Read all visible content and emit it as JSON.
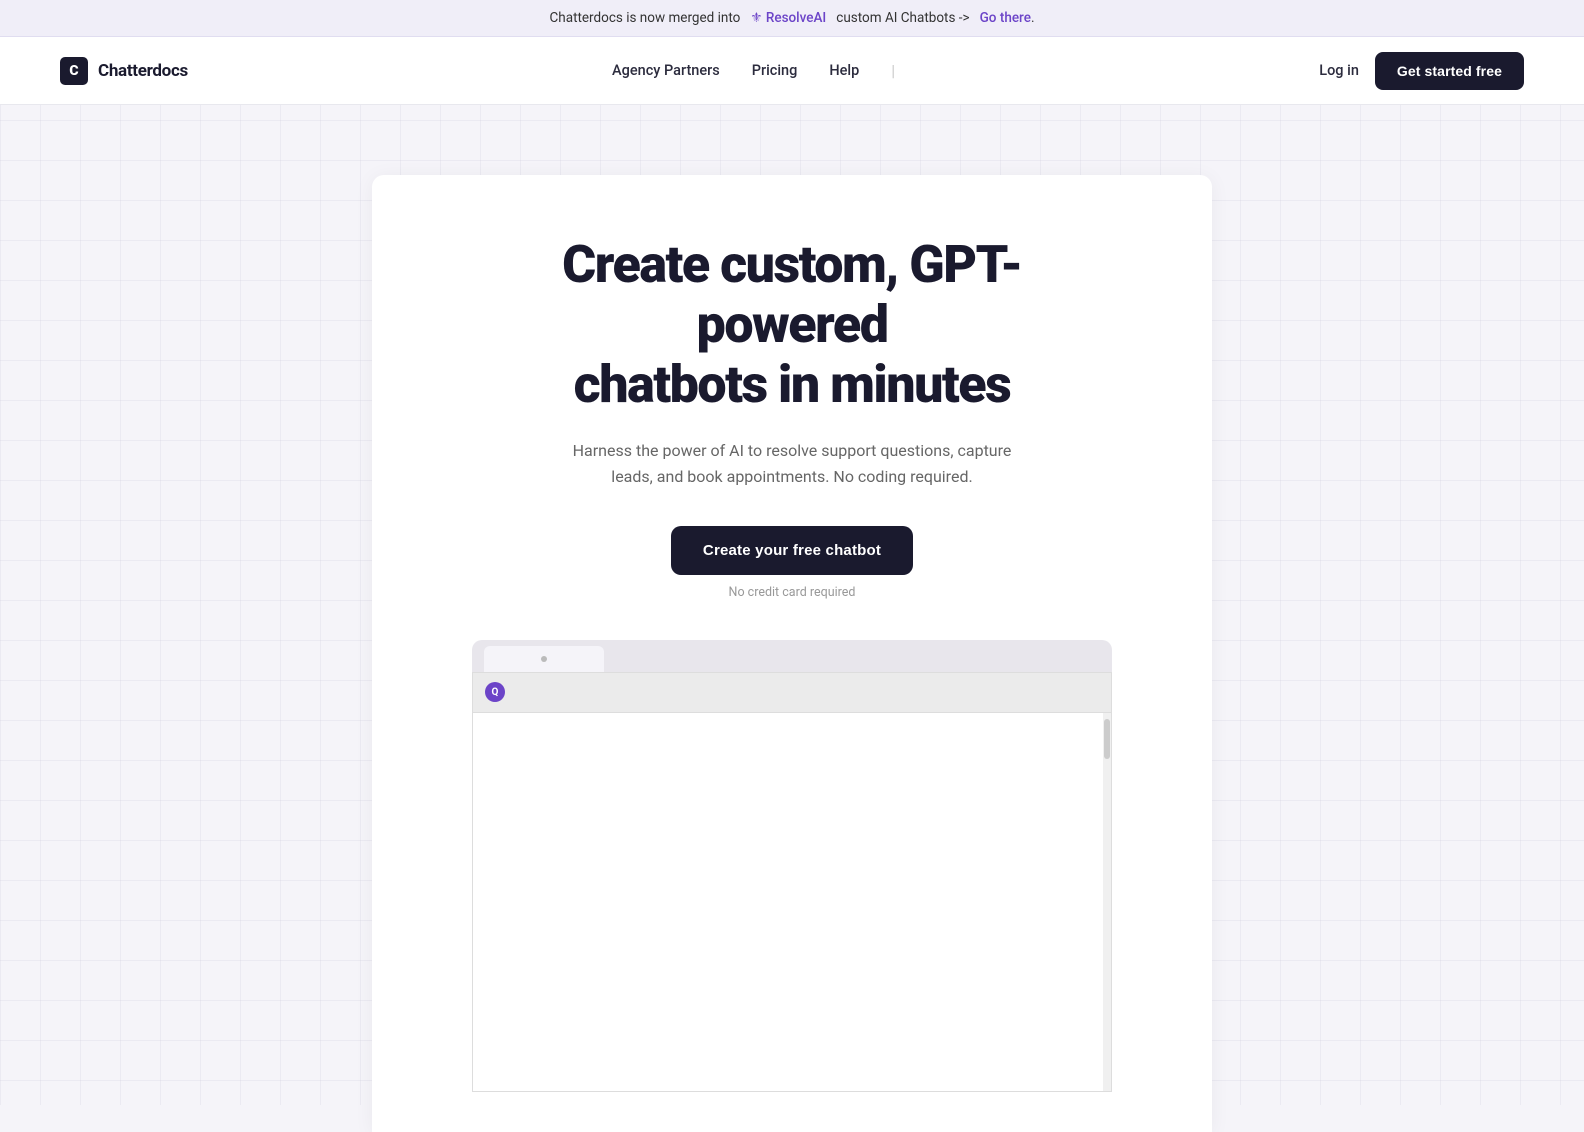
{
  "announcement": {
    "prefix": "Chatterdocs is now merged into",
    "brand": "ResolveAI",
    "middle": "custom AI Chatbots ->",
    "cta": "Go there",
    "cta_punctuation": "."
  },
  "header": {
    "logo_icon": "C",
    "logo_text": "Chatterdocs",
    "nav": {
      "agency_partners": "Agency Partners",
      "pricing": "Pricing",
      "help": "Help"
    },
    "login": "Log in",
    "cta": "Get started free"
  },
  "hero": {
    "title_line1": "Create custom, GPT-powered",
    "title_line2": "chatbots in minutes",
    "subtitle": "Harness the power of AI to resolve support questions, capture leads, and book appointments. No coding required.",
    "cta_button": "Create your free chatbot",
    "no_credit_card": "No credit card required"
  },
  "preview": {
    "resolve_icon_label": "Q"
  }
}
